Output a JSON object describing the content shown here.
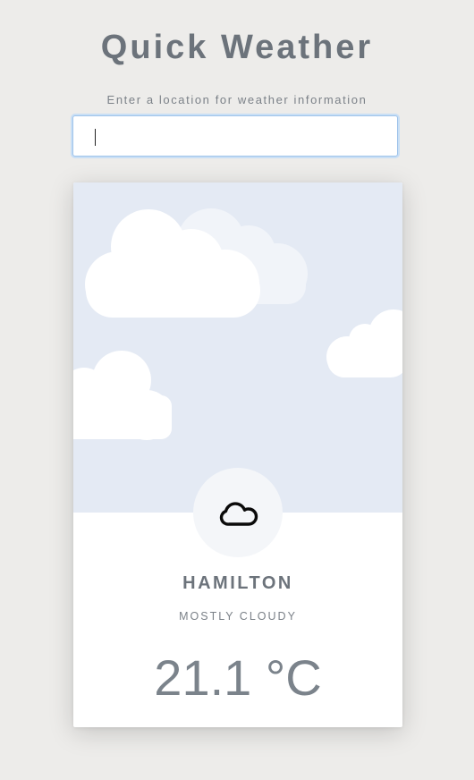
{
  "app": {
    "title": "Quick Weather"
  },
  "search": {
    "prompt": "Enter a location for weather information",
    "value": "",
    "placeholder": ""
  },
  "weather": {
    "icon": "cloud-icon",
    "city": "HAMILTON",
    "condition": "MOSTLY CLOUDY",
    "temperature": "21.1 °C"
  },
  "colors": {
    "background": "#edecea",
    "sky": "#e4eaf4",
    "text": "#6c737b",
    "input_focus": "#9ec3ea"
  }
}
